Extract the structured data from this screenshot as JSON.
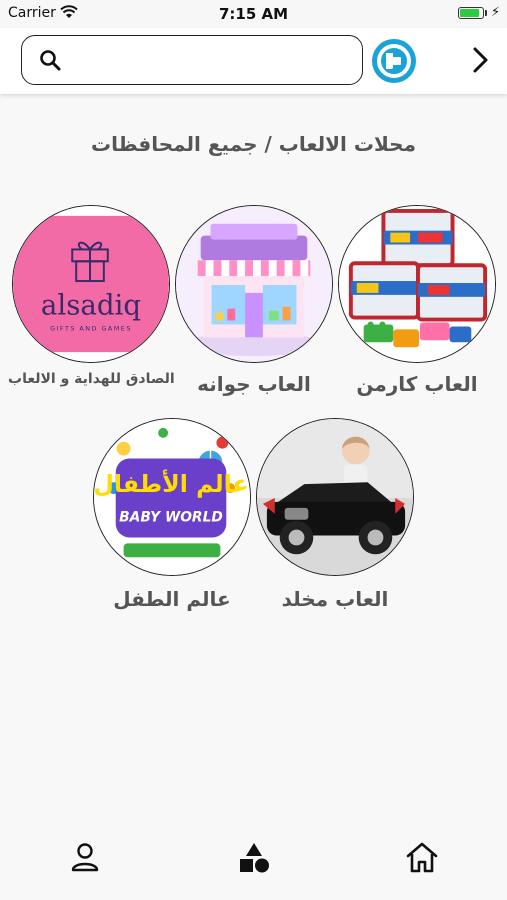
{
  "status_bar": {
    "carrier": "Carrier",
    "time": "7:15 AM",
    "battery_level": 0.9,
    "battery_color": "#2ecc40"
  },
  "header": {
    "search": {
      "value": "",
      "placeholder": ""
    },
    "logo_icon": "app-logo-icon",
    "back_icon": "chevron-right-icon"
  },
  "page": {
    "heading": "محلات الالعاب / جميع المحافظات"
  },
  "stores": [
    {
      "label": "العاب كارمن",
      "image": "toy-buckets-image"
    },
    {
      "label": "العاب جوانه",
      "image": "toy-shop-image"
    },
    {
      "label": "الصادق للهداية و الالعاب",
      "image": "alsadiq-logo-image",
      "image_text": "alsadiq",
      "image_subtext": "GIFTS AND GAMES"
    },
    {
      "label": "العاب مخلد",
      "image": "kids-car-image"
    },
    {
      "label": "عالم الطفل",
      "image": "baby-world-logo-image",
      "image_text": "عالم الأطفال",
      "image_subtext": "BABY WORLD"
    }
  ],
  "tab_bar": {
    "items": [
      {
        "icon": "profile-icon"
      },
      {
        "icon": "categories-icon"
      },
      {
        "icon": "home-icon"
      }
    ]
  },
  "colors": {
    "accent": "#1aa3d6",
    "heading_text": "#555555",
    "alsadiq_background": "#f26ba6"
  }
}
